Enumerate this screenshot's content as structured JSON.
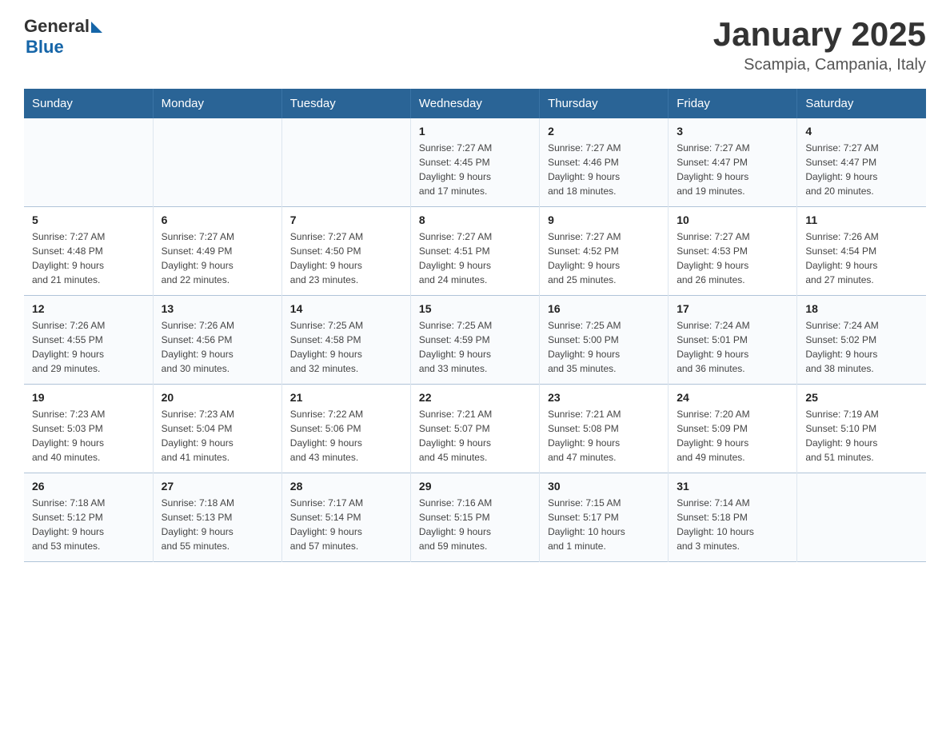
{
  "header": {
    "logo_general": "General",
    "logo_blue": "Blue",
    "title": "January 2025",
    "subtitle": "Scampia, Campania, Italy"
  },
  "weekdays": [
    "Sunday",
    "Monday",
    "Tuesday",
    "Wednesday",
    "Thursday",
    "Friday",
    "Saturday"
  ],
  "weeks": [
    [
      {
        "day": "",
        "info": ""
      },
      {
        "day": "",
        "info": ""
      },
      {
        "day": "",
        "info": ""
      },
      {
        "day": "1",
        "info": "Sunrise: 7:27 AM\nSunset: 4:45 PM\nDaylight: 9 hours\nand 17 minutes."
      },
      {
        "day": "2",
        "info": "Sunrise: 7:27 AM\nSunset: 4:46 PM\nDaylight: 9 hours\nand 18 minutes."
      },
      {
        "day": "3",
        "info": "Sunrise: 7:27 AM\nSunset: 4:47 PM\nDaylight: 9 hours\nand 19 minutes."
      },
      {
        "day": "4",
        "info": "Sunrise: 7:27 AM\nSunset: 4:47 PM\nDaylight: 9 hours\nand 20 minutes."
      }
    ],
    [
      {
        "day": "5",
        "info": "Sunrise: 7:27 AM\nSunset: 4:48 PM\nDaylight: 9 hours\nand 21 minutes."
      },
      {
        "day": "6",
        "info": "Sunrise: 7:27 AM\nSunset: 4:49 PM\nDaylight: 9 hours\nand 22 minutes."
      },
      {
        "day": "7",
        "info": "Sunrise: 7:27 AM\nSunset: 4:50 PM\nDaylight: 9 hours\nand 23 minutes."
      },
      {
        "day": "8",
        "info": "Sunrise: 7:27 AM\nSunset: 4:51 PM\nDaylight: 9 hours\nand 24 minutes."
      },
      {
        "day": "9",
        "info": "Sunrise: 7:27 AM\nSunset: 4:52 PM\nDaylight: 9 hours\nand 25 minutes."
      },
      {
        "day": "10",
        "info": "Sunrise: 7:27 AM\nSunset: 4:53 PM\nDaylight: 9 hours\nand 26 minutes."
      },
      {
        "day": "11",
        "info": "Sunrise: 7:26 AM\nSunset: 4:54 PM\nDaylight: 9 hours\nand 27 minutes."
      }
    ],
    [
      {
        "day": "12",
        "info": "Sunrise: 7:26 AM\nSunset: 4:55 PM\nDaylight: 9 hours\nand 29 minutes."
      },
      {
        "day": "13",
        "info": "Sunrise: 7:26 AM\nSunset: 4:56 PM\nDaylight: 9 hours\nand 30 minutes."
      },
      {
        "day": "14",
        "info": "Sunrise: 7:25 AM\nSunset: 4:58 PM\nDaylight: 9 hours\nand 32 minutes."
      },
      {
        "day": "15",
        "info": "Sunrise: 7:25 AM\nSunset: 4:59 PM\nDaylight: 9 hours\nand 33 minutes."
      },
      {
        "day": "16",
        "info": "Sunrise: 7:25 AM\nSunset: 5:00 PM\nDaylight: 9 hours\nand 35 minutes."
      },
      {
        "day": "17",
        "info": "Sunrise: 7:24 AM\nSunset: 5:01 PM\nDaylight: 9 hours\nand 36 minutes."
      },
      {
        "day": "18",
        "info": "Sunrise: 7:24 AM\nSunset: 5:02 PM\nDaylight: 9 hours\nand 38 minutes."
      }
    ],
    [
      {
        "day": "19",
        "info": "Sunrise: 7:23 AM\nSunset: 5:03 PM\nDaylight: 9 hours\nand 40 minutes."
      },
      {
        "day": "20",
        "info": "Sunrise: 7:23 AM\nSunset: 5:04 PM\nDaylight: 9 hours\nand 41 minutes."
      },
      {
        "day": "21",
        "info": "Sunrise: 7:22 AM\nSunset: 5:06 PM\nDaylight: 9 hours\nand 43 minutes."
      },
      {
        "day": "22",
        "info": "Sunrise: 7:21 AM\nSunset: 5:07 PM\nDaylight: 9 hours\nand 45 minutes."
      },
      {
        "day": "23",
        "info": "Sunrise: 7:21 AM\nSunset: 5:08 PM\nDaylight: 9 hours\nand 47 minutes."
      },
      {
        "day": "24",
        "info": "Sunrise: 7:20 AM\nSunset: 5:09 PM\nDaylight: 9 hours\nand 49 minutes."
      },
      {
        "day": "25",
        "info": "Sunrise: 7:19 AM\nSunset: 5:10 PM\nDaylight: 9 hours\nand 51 minutes."
      }
    ],
    [
      {
        "day": "26",
        "info": "Sunrise: 7:18 AM\nSunset: 5:12 PM\nDaylight: 9 hours\nand 53 minutes."
      },
      {
        "day": "27",
        "info": "Sunrise: 7:18 AM\nSunset: 5:13 PM\nDaylight: 9 hours\nand 55 minutes."
      },
      {
        "day": "28",
        "info": "Sunrise: 7:17 AM\nSunset: 5:14 PM\nDaylight: 9 hours\nand 57 minutes."
      },
      {
        "day": "29",
        "info": "Sunrise: 7:16 AM\nSunset: 5:15 PM\nDaylight: 9 hours\nand 59 minutes."
      },
      {
        "day": "30",
        "info": "Sunrise: 7:15 AM\nSunset: 5:17 PM\nDaylight: 10 hours\nand 1 minute."
      },
      {
        "day": "31",
        "info": "Sunrise: 7:14 AM\nSunset: 5:18 PM\nDaylight: 10 hours\nand 3 minutes."
      },
      {
        "day": "",
        "info": ""
      }
    ]
  ]
}
